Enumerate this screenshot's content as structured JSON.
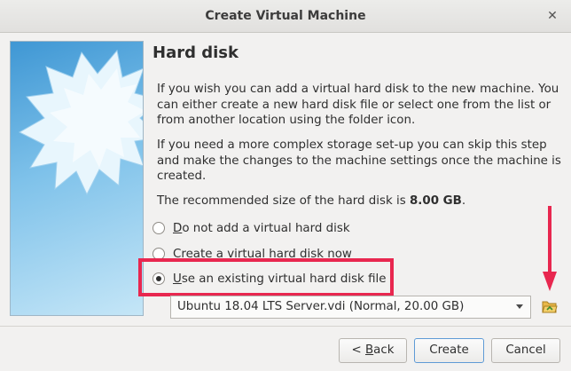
{
  "window": {
    "title": "Create Virtual Machine",
    "close_glyph": "✕"
  },
  "page": {
    "heading": "Hard disk",
    "paragraph1": "If you wish you can add a virtual hard disk to the new machine. You can either create a new hard disk file or select one from the list or from another location using the folder icon.",
    "paragraph2": "If you need a more complex storage set-up you can skip this step and make the changes to the machine settings once the machine is created.",
    "recommended_prefix": "The recommended size of the hard disk is ",
    "recommended_size": "8.00 GB",
    "recommended_suffix": "."
  },
  "options": [
    {
      "mnemonic": "D",
      "rest": "o not add a virtual hard disk",
      "selected": false
    },
    {
      "mnemonic": "C",
      "rest": "reate a virtual hard disk now",
      "selected": false
    },
    {
      "mnemonic": "U",
      "rest": "se an existing virtual hard disk file",
      "selected": true
    }
  ],
  "disk_select": {
    "value": "Ubuntu 18.04 LTS Server.vdi (Normal, 20.00 GB)"
  },
  "icons": {
    "folder": "folder-open-icon",
    "arrow": "red-down-arrow-icon",
    "side": "virtualbox-starburst-icon"
  },
  "buttons": {
    "back_prefix": "< ",
    "back_mnemonic": "B",
    "back_rest": "ack",
    "create": "Create",
    "cancel": "Cancel"
  },
  "colors": {
    "highlight": "#e8274f",
    "accent": "#5f9bd6"
  }
}
